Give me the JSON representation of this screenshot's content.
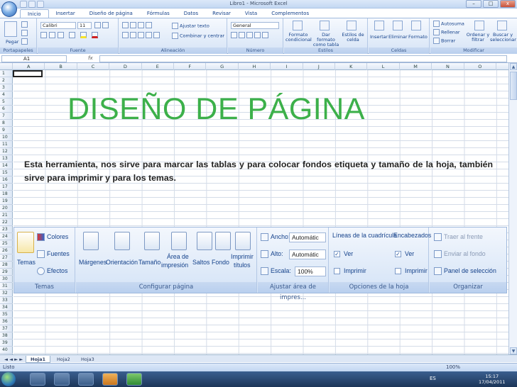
{
  "window": {
    "title": "Libro1 - Microsoft Excel",
    "min": "–",
    "max": "□",
    "close": "x"
  },
  "ribbon_tabs": [
    "Inicio",
    "Insertar",
    "Diseño de página",
    "Fórmulas",
    "Datos",
    "Revisar",
    "Vista",
    "Complementos"
  ],
  "ribbon": {
    "paste": "Pegar",
    "font_name": "Calibri",
    "font_size": "11",
    "wrap_text": "Ajustar texto",
    "merge": "Combinar y centrar",
    "number_format": "General",
    "cond_format": "Formato condicional",
    "format_table": "Dar formato como tabla",
    "cell_styles": "Estilos de celda",
    "insert": "Insertar",
    "delete": "Eliminar",
    "format": "Formato",
    "autosum": "Autosuma",
    "fill": "Rellenar",
    "clear": "Borrar",
    "sort": "Ordenar y filtrar",
    "find": "Buscar y seleccionar",
    "groups": [
      "Portapapeles",
      "Fuente",
      "Alineación",
      "Número",
      "Estilos",
      "Celdas",
      "Modificar"
    ]
  },
  "namebox": "A1",
  "fx": "fx",
  "columns": [
    "A",
    "B",
    "C",
    "D",
    "E",
    "F",
    "G",
    "H",
    "I",
    "J",
    "K",
    "L",
    "M",
    "N",
    "O"
  ],
  "rows": [
    "1",
    "2",
    "3",
    "4",
    "5",
    "6",
    "7",
    "8",
    "9",
    "10",
    "11",
    "12",
    "13",
    "14",
    "15",
    "16",
    "17",
    "18",
    "19",
    "20",
    "21",
    "22",
    "23",
    "24",
    "25",
    "26",
    "27",
    "28",
    "29",
    "30",
    "31",
    "32",
    "33",
    "34",
    "35",
    "36",
    "37",
    "38",
    "39",
    "40"
  ],
  "slide": {
    "title": "DISEÑO DE PÁGINA",
    "description": "Esta herramienta, nos sirve para marcar las tablas y para colocar fondos etiqueta y tamaño de la hoja, también sirve para imprimir y para los temas."
  },
  "inset": {
    "temas": "Temas",
    "colores": "Colores",
    "fuentes": "Fuentes",
    "efectos": "Efectos",
    "margenes": "Márgenes",
    "orientacion": "Orientación",
    "tamano": "Tamaño",
    "area_line1": "Área de",
    "area_line2": "impresión",
    "saltos": "Saltos",
    "fondo": "Fondo",
    "imprimir_line1": "Imprimir",
    "imprimir_line2": "títulos",
    "ancho_label": "Ancho:",
    "ancho_value": "Automátic",
    "alto_label": "Alto:",
    "alto_value": "Automátic",
    "escala_label": "Escala:",
    "escala_value": "100%",
    "lineas": "Líneas de la cuadrícula",
    "encabezados": "Encabezados",
    "ver1": "Ver",
    "ver2": "Ver",
    "imprimir1": "Imprimir",
    "imprimir2": "Imprimir",
    "traer": "Traer al frente",
    "enviar": "Enviar al fondo",
    "panel": "Panel de selección",
    "group_labels": [
      "Temas",
      "Configurar página",
      "Ajustar área de impres...",
      "Opciones de la hoja",
      "Organizar"
    ]
  },
  "sheets": [
    "Hoja1",
    "Hoja2",
    "Hoja3"
  ],
  "status": {
    "ready": "Listo",
    "zoom": "100%"
  },
  "taskbar": {
    "lang": "ES",
    "time": "15:17",
    "date": "17/04/2011"
  }
}
